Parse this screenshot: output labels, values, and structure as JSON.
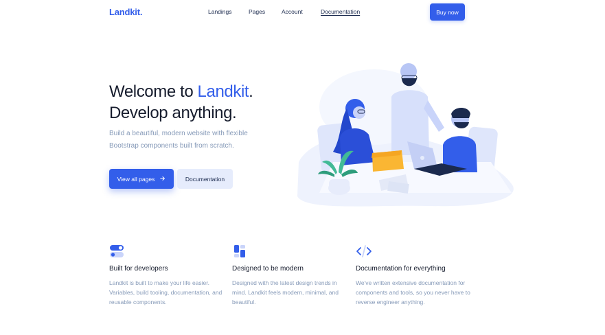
{
  "brand": {
    "name": "Landkit",
    "dot": "."
  },
  "nav": {
    "links": [
      "Landings",
      "Pages",
      "Account",
      "Documentation"
    ],
    "buy_label": "Buy now"
  },
  "hero": {
    "title_line1_prefix": "Welcome to ",
    "title_line1_accent": "Landkit",
    "title_line1_suffix": ".",
    "title_line2": "Develop anything.",
    "subtitle": "Build a beautiful, modern website with flexible Bootstrap components built from scratch.",
    "primary_button": "View all pages",
    "primary_button_icon": "arrow-right-icon",
    "secondary_button": "Documentation"
  },
  "features": [
    {
      "icon": "toggle-icon",
      "title": "Built for developers",
      "text": "Landkit is built to make your life easier. Variables, build tooling, documentation, and reusable components."
    },
    {
      "icon": "layout-icon",
      "title": "Designed to be modern",
      "text": "Designed with the latest design trends in mind. Landkit feels modern, minimal, and beautiful."
    },
    {
      "icon": "code-icon",
      "title": "Documentation for everything",
      "text": "We've written extensive documentation for components and tools, so you never have to reverse engineer anything."
    }
  ],
  "colors": {
    "primary": "#335eea",
    "text_dark": "#161c2d",
    "text_muted": "#869ab8",
    "primary_soft": "#e6ecfc"
  }
}
